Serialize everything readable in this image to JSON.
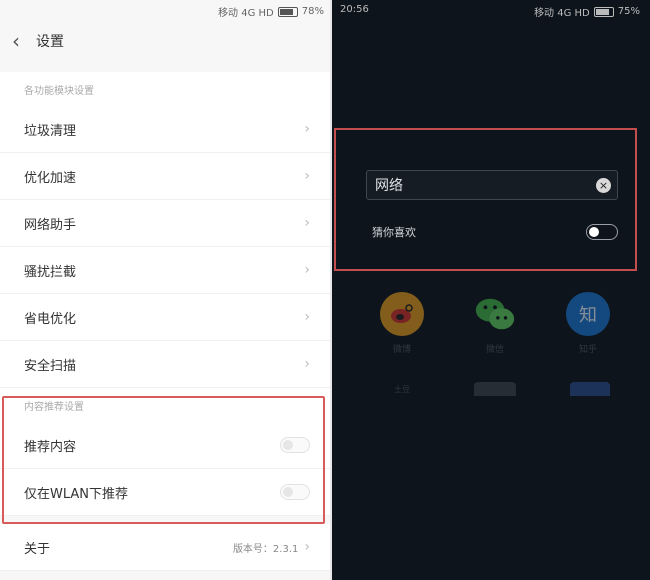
{
  "left": {
    "status": {
      "carrier": "移动 4G HD",
      "battery": "78%"
    },
    "header": {
      "title": "设置"
    },
    "section1": {
      "label": "各功能模块设置"
    },
    "items": [
      {
        "label": "垃圾清理"
      },
      {
        "label": "优化加速"
      },
      {
        "label": "网络助手"
      },
      {
        "label": "骚扰拦截"
      },
      {
        "label": "省电优化"
      },
      {
        "label": "安全扫描"
      }
    ],
    "section2": {
      "label": "内容推荐设置"
    },
    "toggles": [
      {
        "label": "推荐内容",
        "on": false
      },
      {
        "label": "仅在WLAN下推荐",
        "on": false
      }
    ],
    "about": {
      "label": "关于",
      "version": "版本号：2.3.1"
    }
  },
  "right": {
    "status": {
      "time": "20:56",
      "carrier": "移动 4G HD",
      "battery": "75%"
    },
    "search": {
      "value": "网络"
    },
    "guess": {
      "label": "猜你喜欢",
      "on": false
    },
    "apps": [
      {
        "label": "微博",
        "icon": "weibo-icon",
        "color": "#f0a020"
      },
      {
        "label": "微信",
        "icon": "wechat-icon",
        "color": "#4caf50"
      },
      {
        "label": "知乎",
        "icon": "zhihu-icon",
        "color": "#1e88e5",
        "glyph": "知"
      }
    ],
    "apps_row2": [
      {
        "label": "土豆"
      }
    ]
  }
}
